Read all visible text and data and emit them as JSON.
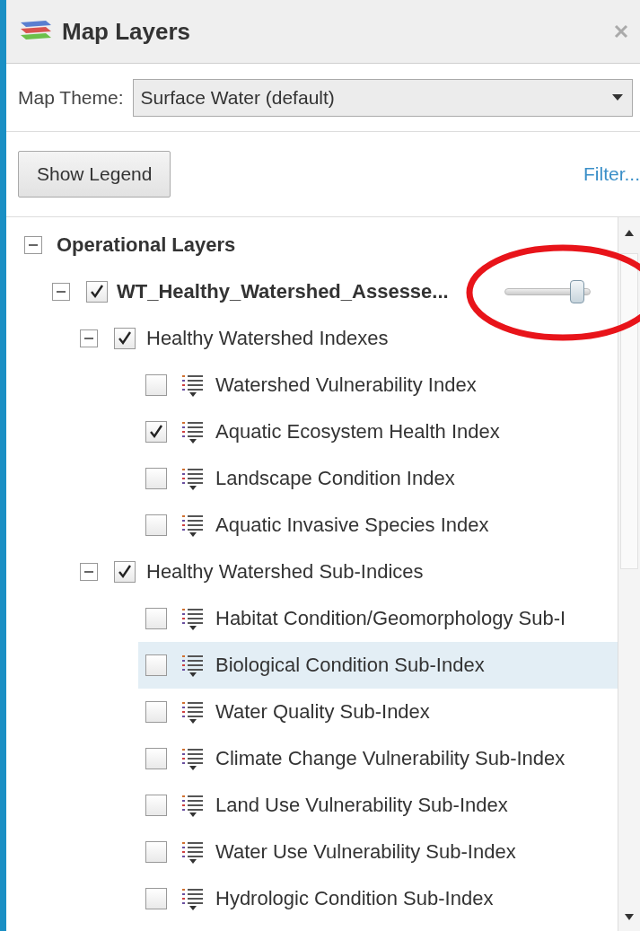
{
  "panel": {
    "title": "Map Layers"
  },
  "theme": {
    "label": "Map Theme:",
    "value": "Surface Water (default)"
  },
  "show_legend_button": "Show Legend",
  "filter_link": "Filter...",
  "layers": [
    {
      "kind": "root",
      "label": "Operational Layers",
      "expanded": true,
      "children": [
        {
          "kind": "service",
          "label": "WT_Healthy_Watershed_Assesse...",
          "checked": true,
          "expanded": true,
          "opacity": {
            "level": 0.85
          },
          "children": [
            {
              "kind": "group",
              "label": "Healthy Watershed Indexes",
              "checked": true,
              "expanded": true,
              "children": [
                {
                  "kind": "layer",
                  "label": "Watershed Vulnerability Index",
                  "checked": false,
                  "selected": false
                },
                {
                  "kind": "layer",
                  "label": "Aquatic Ecosystem Health Index",
                  "checked": true,
                  "selected": false
                },
                {
                  "kind": "layer",
                  "label": "Landscape Condition Index",
                  "checked": false,
                  "selected": false
                },
                {
                  "kind": "layer",
                  "label": "Aquatic Invasive Species Index",
                  "checked": false,
                  "selected": false
                }
              ]
            },
            {
              "kind": "group",
              "label": "Healthy Watershed Sub-Indices",
              "checked": true,
              "expanded": true,
              "children": [
                {
                  "kind": "layer",
                  "label": "Habitat Condition/Geomorphology Sub-I",
                  "checked": false,
                  "selected": false
                },
                {
                  "kind": "layer",
                  "label": "Biological Condition Sub-Index",
                  "checked": false,
                  "selected": true
                },
                {
                  "kind": "layer",
                  "label": "Water Quality Sub-Index",
                  "checked": false,
                  "selected": false
                },
                {
                  "kind": "layer",
                  "label": "Climate Change Vulnerability Sub-Index",
                  "checked": false,
                  "selected": false
                },
                {
                  "kind": "layer",
                  "label": "Land Use Vulnerability Sub-Index",
                  "checked": false,
                  "selected": false
                },
                {
                  "kind": "layer",
                  "label": "Water Use Vulnerability Sub-Index",
                  "checked": false,
                  "selected": false
                },
                {
                  "kind": "layer",
                  "label": "Hydrologic Condition Sub-Index",
                  "checked": false,
                  "selected": false
                }
              ]
            }
          ]
        }
      ]
    }
  ]
}
